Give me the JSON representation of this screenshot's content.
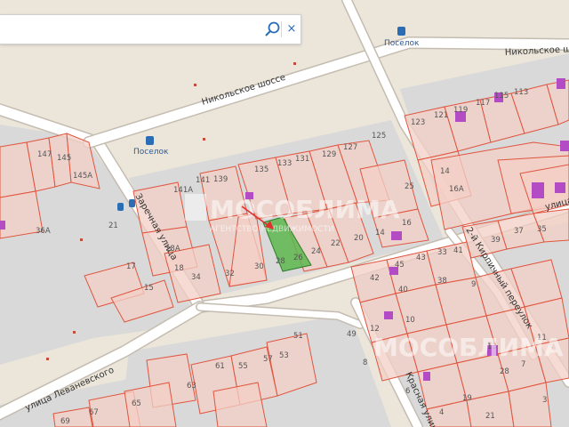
{
  "search": {
    "value": "",
    "placeholder": "",
    "search_icon": "search-icon",
    "clear_label": "×"
  },
  "streets": {
    "nikolskoe_shosse_1": "Никольское шоссе",
    "nikolskoe_shosse_2": "Никольское шоссе",
    "zarechnaya": "Заречная улица",
    "levanevskogo": "улица Леваневского",
    "pereulok_2": "2-й Кирпичный переулок",
    "krasnaya": "Красная улица",
    "ulitsa_partial": "улица"
  },
  "bus_stops": {
    "poselok_1": "Поселок",
    "poselok_2": "Поселок"
  },
  "watermark": {
    "main": "МОСОБЛИМА",
    "sub": "АГЕНТСТВО НЕДВИЖИМОСТИ",
    "logo_icon": "building-logo-icon"
  },
  "house_numbers": {
    "n145": "145",
    "n145a": "145A",
    "n147": "147",
    "n36a": "36A",
    "n21": "21",
    "n17": "17",
    "n15": "15",
    "n141a": "141A",
    "n141": "141",
    "n139": "139",
    "n135": "135",
    "n133": "133",
    "n131": "131",
    "n129": "129",
    "n127": "127",
    "n125": "125",
    "n18a": "18A",
    "n18": "18",
    "n34": "34",
    "n32": "32",
    "n30": "30",
    "n28": "28",
    "n26": "26",
    "n24": "24",
    "n22": "22",
    "n20": "20",
    "n14": "14",
    "n25": "25",
    "n16": "16",
    "n123": "123",
    "n121": "121",
    "n119": "119",
    "n117": "117",
    "n115": "115",
    "n113": "113",
    "n14r": "14",
    "n16a": "16A",
    "n39": "39",
    "n37": "37",
    "n35": "35",
    "n33": "33",
    "n41": "41",
    "n43": "43",
    "n45": "45",
    "n42": "42",
    "n40": "40",
    "n38": "38",
    "n12": "12",
    "n10": "10",
    "n9": "9",
    "n13": "13",
    "n11": "11",
    "n8": "8",
    "n6": "6",
    "n4": "4",
    "n7": "7",
    "n3": "3",
    "n51": "51",
    "n49": "49",
    "n57": "57",
    "n55": "55",
    "n53": "53",
    "n63": "63",
    "n61": "61",
    "n67": "67",
    "n65": "65",
    "n69": "69",
    "n28b": "28",
    "n19": "19",
    "n21b": "21"
  },
  "colors": {
    "background": "#ece6da",
    "block": "#d7d7d7",
    "road": "#ffffff",
    "road_edge": "#c4bcb0",
    "parcel_fill": "#f3cfc5",
    "parcel_stroke": "#e0553f",
    "highlight_parcel": "#5db64e",
    "building": "#b24bc4",
    "marker": "#e03030",
    "bus_stop": "#2a6db5"
  },
  "map_layers": {
    "selected_parcel": "selected-parcel",
    "pin": "location-marker-icon"
  }
}
